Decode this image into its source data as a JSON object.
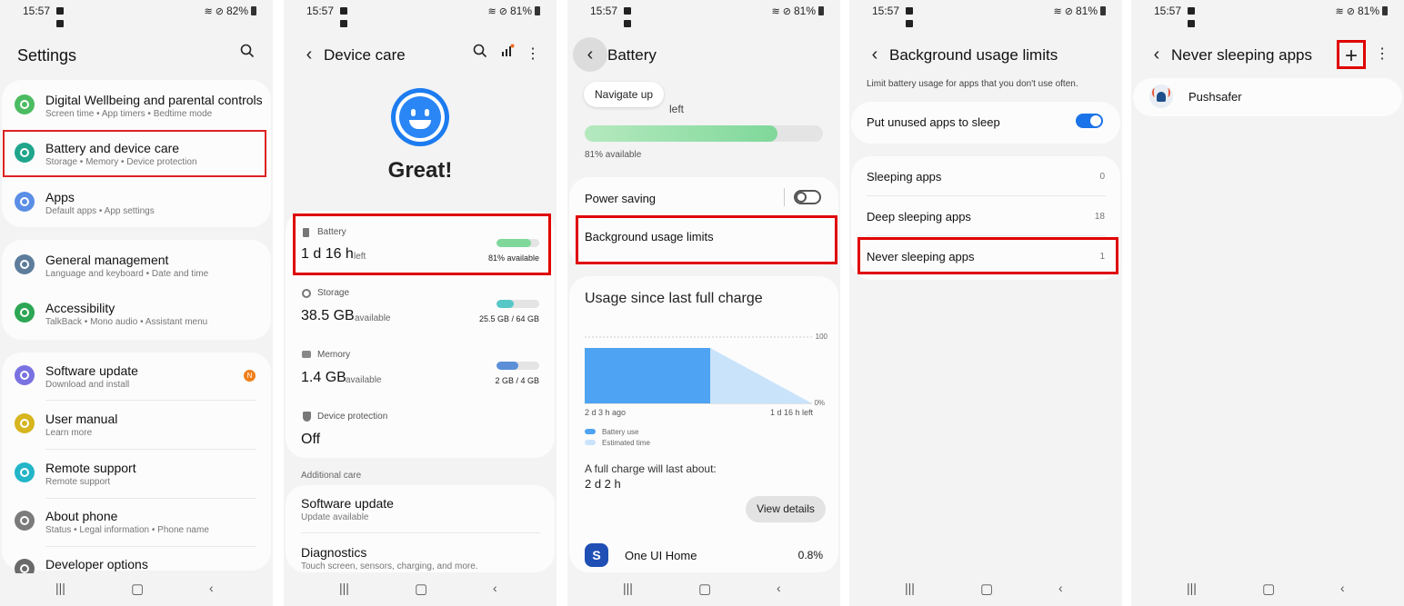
{
  "status": {
    "time": "15:57",
    "battery": [
      "82%",
      "81%",
      "81%",
      "81%",
      "81%"
    ]
  },
  "colors": {
    "accent": "#1a73e8",
    "highlight_red": "#e00000",
    "battery_green": "#7fd89a",
    "storage_teal": "#58c7c7",
    "memory_blue": "#5b8fd8",
    "badge_orange": "#f07f1a"
  },
  "screen1": {
    "title": "Settings",
    "search_icon": "search-icon",
    "items": [
      {
        "title": "Digital Wellbeing and parental controls",
        "sub": "Screen time  •  App timers  •  Bedtime mode",
        "icon": "wellbeing-icon",
        "color": "#4cbc62"
      },
      {
        "title": "Battery and device care",
        "sub": "Storage  •  Memory  •  Device protection",
        "icon": "device-care-icon",
        "color": "#1fa58c"
      },
      {
        "title": "Apps",
        "sub": "Default apps  •  App settings",
        "icon": "apps-icon",
        "color": "#5b8fe6"
      },
      {
        "title": "General management",
        "sub": "Language and keyboard  •  Date and time",
        "icon": "sliders-icon",
        "color": "#5e7d9b"
      },
      {
        "title": "Accessibility",
        "sub": "TalkBack  •  Mono audio  •  Assistant menu",
        "icon": "accessibility-icon",
        "color": "#2da655"
      },
      {
        "title": "Software update",
        "sub": "Download and install",
        "icon": "update-icon",
        "color": "#7a72e0",
        "badge": "N"
      },
      {
        "title": "User manual",
        "sub": "Learn more",
        "icon": "manual-icon",
        "color": "#d6b51f"
      },
      {
        "title": "Remote support",
        "sub": "Remote support",
        "icon": "headset-icon",
        "color": "#23b5c8"
      },
      {
        "title": "About phone",
        "sub": "Status  •  Legal information  •  Phone name",
        "icon": "info-icon",
        "color": "#7b7b7b"
      },
      {
        "title": "Developer options",
        "sub": "",
        "icon": "developer-icon",
        "color": "#6a6a6a"
      }
    ]
  },
  "screen2": {
    "title": "Device care",
    "status_text": "Great!",
    "battery": {
      "label": "Battery",
      "value": "1 d 16 h",
      "unit": "left",
      "right": "81% available",
      "fill": 0.81
    },
    "storage": {
      "label": "Storage",
      "value": "38.5 GB",
      "unit": "available",
      "right": "25.5 GB / 64 GB",
      "fill": 0.4
    },
    "memory": {
      "label": "Memory",
      "value": "1.4 GB",
      "unit": "available",
      "right": "2 GB / 4 GB",
      "fill": 0.5
    },
    "protection": {
      "label": "Device protection",
      "value": "Off"
    },
    "additional": "Additional care",
    "software_update": {
      "title": "Software update",
      "sub": "Update available"
    },
    "diagnostics": {
      "title": "Diagnostics",
      "sub": "Touch screen, sensors, charging, and more."
    }
  },
  "screen3": {
    "title": "Battery",
    "tooltip": "Navigate up",
    "left_text": "left",
    "available": "81% available",
    "battery_fill": 0.81,
    "power_saving": "Power saving",
    "bg_limits": "Background usage limits",
    "usage_title": "Usage since last full charge",
    "axis_top": "100",
    "axis_bottom": "0%",
    "x_left": "2 d 3 h ago",
    "x_right": "1 d 16 h left",
    "legend_battery": "Battery use",
    "legend_estimated": "Estimated time",
    "full_charge_label": "A full charge will last about:",
    "full_charge_value": "2 d 2 h",
    "view_details": "View details",
    "app_name": "One UI Home",
    "app_pct": "0.8%"
  },
  "screen4": {
    "title": "Background usage limits",
    "description": "Limit battery usage for apps that you don't use often.",
    "put_unused": "Put unused apps to sleep",
    "put_unused_on": true,
    "rows": [
      {
        "title": "Sleeping apps",
        "count": "0"
      },
      {
        "title": "Deep sleeping apps",
        "count": "18"
      },
      {
        "title": "Never sleeping apps",
        "count": "1"
      }
    ]
  },
  "screen5": {
    "title": "Never sleeping apps",
    "add_icon": "plus-icon",
    "app": "Pushsafer"
  }
}
